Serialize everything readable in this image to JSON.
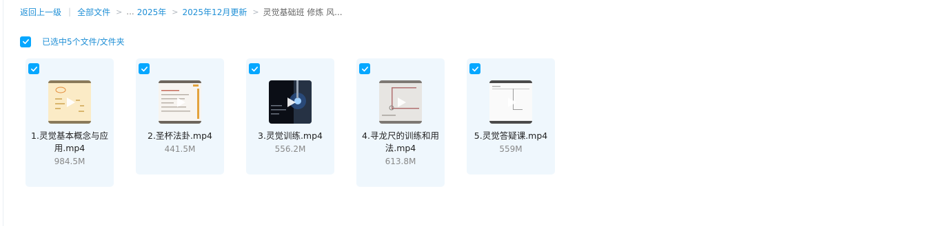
{
  "breadcrumb": {
    "back": "返回上一级",
    "all_files": "全部文件",
    "ellipsis": "...",
    "level1": "2025年",
    "level2": "2025年12月更新",
    "current": "灵觉基础班 修炼 风..."
  },
  "selection": {
    "label": "已选中5个文件/文件夹",
    "checked": true
  },
  "colors": {
    "accent": "#06a7ff",
    "link": "#1f8fd6",
    "card_bg": "#eff7fd"
  },
  "files": [
    {
      "name": "1.灵觉基本概念与应用.mp4",
      "size": "984.5M",
      "thumb": "video-thumbnail"
    },
    {
      "name": "2.圣杯法卦.mp4",
      "size": "441.5M",
      "thumb": "video-thumbnail"
    },
    {
      "name": "3.灵觉训练.mp4",
      "size": "556.2M",
      "thumb": "video-thumbnail"
    },
    {
      "name": "4.寻龙尺的训练和用法.mp4",
      "size": "613.8M",
      "thumb": "video-thumbnail"
    },
    {
      "name": "5.灵觉答疑课.mp4",
      "size": "559M",
      "thumb": "video-thumbnail"
    }
  ]
}
